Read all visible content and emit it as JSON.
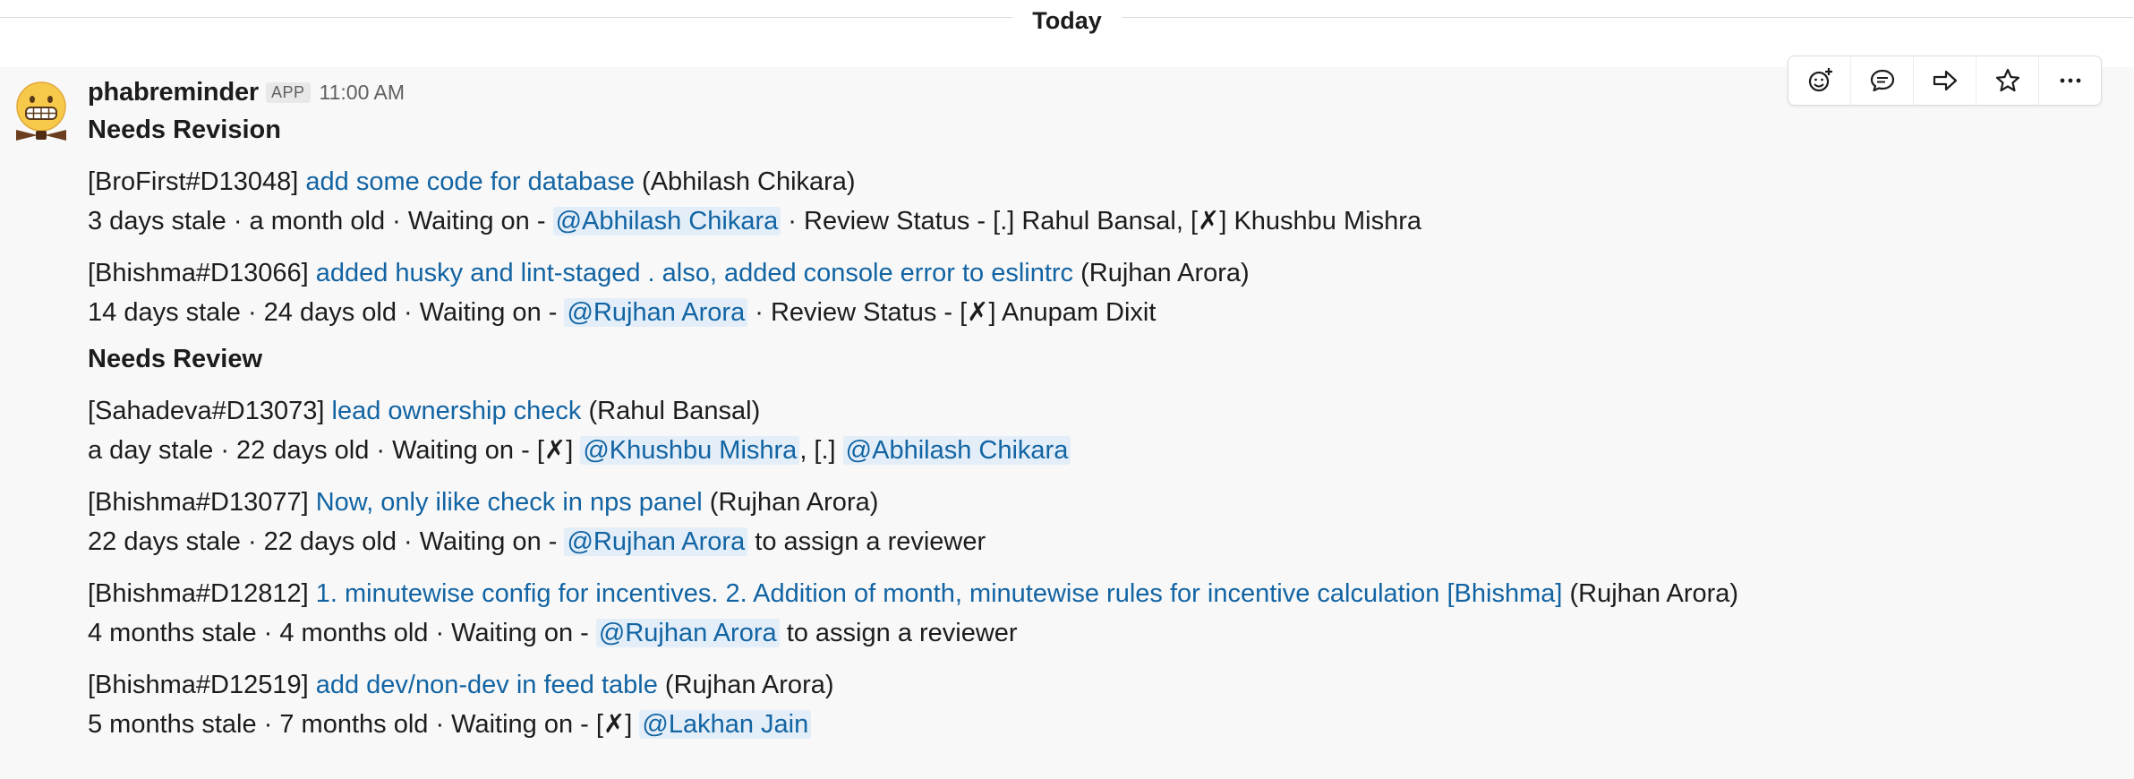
{
  "divider": {
    "label": "Today"
  },
  "message": {
    "sender": "phabreminder",
    "badge": "APP",
    "time": "11:00 AM",
    "sections": [
      {
        "title": "Needs Revision",
        "items": [
          {
            "ref": "[BroFirst#D13048]",
            "link": "add some code for database",
            "author": "(Abhilash Chikara)",
            "stale": "3 days stale ·  a month old · Waiting on -",
            "mention": "@Abhilash Chikara",
            "after_mention": "· Review Status - [.] Rahul Bansal, [✗] Khushbu Mishra"
          },
          {
            "ref": "[Bhishma#D13066]",
            "link": "added husky and lint-staged . also, added console error to eslintrc",
            "author": "(Rujhan Arora)",
            "stale": "14 days stale ·  24 days old · Waiting on -",
            "mention": "@Rujhan Arora",
            "after_mention": "· Review Status - [✗] Anupam Dixit"
          }
        ]
      },
      {
        "title": "Needs Review",
        "items": [
          {
            "ref": "[Sahadeva#D13073]",
            "link": "lead ownership check",
            "author": "(Rahul Bansal)",
            "stale": "a day stale ·  22 days old · Waiting on - [✗]",
            "mention": "@Khushbu Mishra",
            "between": ", [.]",
            "mention2": "@Abhilash Chikara"
          },
          {
            "ref": "[Bhishma#D13077]",
            "link": "Now, only ilike check in nps panel",
            "author": "(Rujhan Arora)",
            "stale": "22 days stale ·  22 days old · Waiting on -",
            "mention": "@Rujhan Arora",
            "after_mention": "to assign a reviewer"
          },
          {
            "ref": "[Bhishma#D12812]",
            "link": "1. minutewise config for incentives. 2. Addition of month, minutewise rules for incentive calculation [Bhishma]",
            "author": "(Rujhan Arora)",
            "stale": "4 months stale ·  4 months old · Waiting on -",
            "mention": "@Rujhan Arora",
            "after_mention": "to assign a reviewer"
          },
          {
            "ref": "[Bhishma#D12519]",
            "link": "add dev/non-dev in feed table",
            "author": "(Rujhan Arora)",
            "stale": "5 months stale ·  7 months old · Waiting on - [✗]",
            "mention": "@Lakhan Jain"
          }
        ]
      }
    ]
  },
  "toolbar": {
    "icons": [
      "add-reaction-icon",
      "reply-thread-icon",
      "share-message-icon",
      "save-star-icon",
      "more-actions-icon"
    ]
  },
  "colors": {
    "link": "#1264a3",
    "mention_bg": "#e3eef8",
    "hover_bg": "#f8f8f8"
  }
}
